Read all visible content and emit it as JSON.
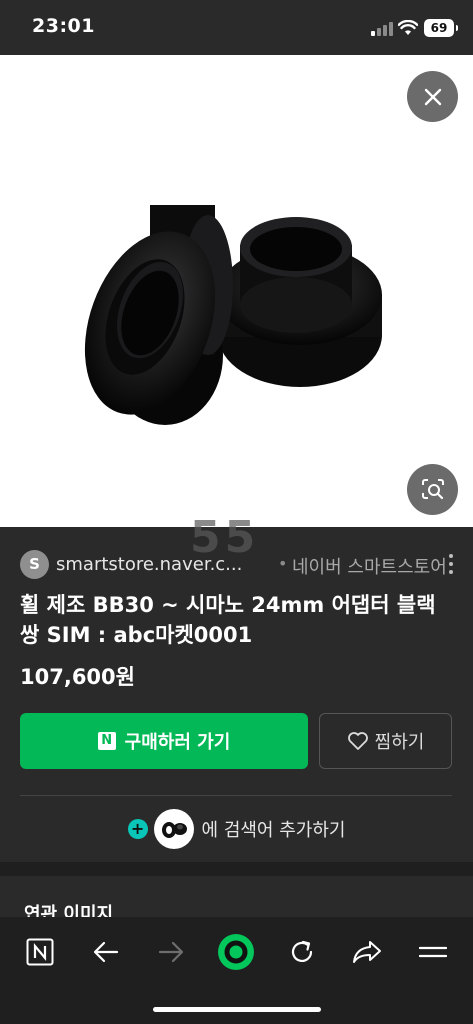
{
  "status_bar": {
    "time": "23:01",
    "battery": "69"
  },
  "source": {
    "avatar_letter": "S",
    "url": "smartstore.naver.c...",
    "separator": "•",
    "name": "네이버 스마트스토어"
  },
  "product": {
    "title": "휠 제조 BB30 ~ 시마노 24mm 어댑터 블랙 쌍 SIM : abc마켓0001",
    "price": "107,600원"
  },
  "actions": {
    "buy_logo": "N",
    "buy_label": "구매하러 가기",
    "wish_label": "찜하기"
  },
  "add_search": {
    "plus": "+",
    "label": "에 검색어 추가하기"
  },
  "related": {
    "title": "연관 이미지"
  },
  "colors": {
    "accent_green": "#03b856",
    "teal": "#09c6b8",
    "background": "#2a2a2b"
  },
  "nav": {
    "icons": [
      "naver-n-icon",
      "back-arrow-icon",
      "forward-arrow-icon",
      "green-home-icon",
      "refresh-icon",
      "share-icon",
      "menu-icon"
    ]
  }
}
